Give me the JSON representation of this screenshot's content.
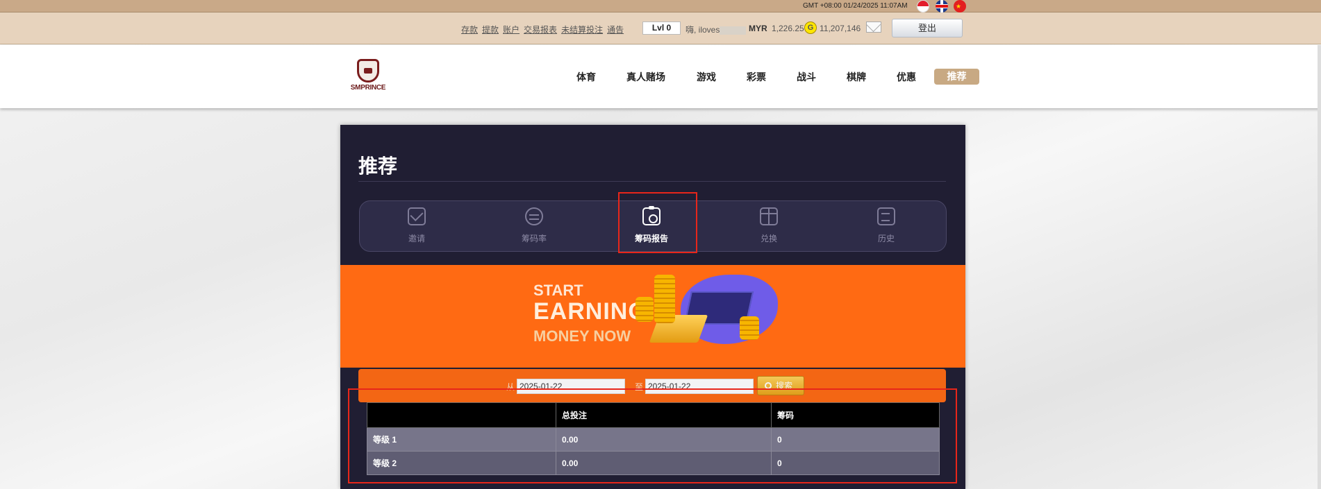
{
  "top_bar": {
    "datetime": "GMT +08:00  01/24/2025 11:07AM",
    "languages": [
      "id-flag-icon",
      "uk-flag-icon",
      "cn-flag-icon"
    ]
  },
  "account_bar": {
    "links": [
      "存款",
      "提款",
      "账户",
      "交易报表",
      "未结算投注",
      "通告"
    ],
    "level": "Lvl 0",
    "greeting": "嗨, iloves",
    "currency": "MYR",
    "balance": "1,226.25",
    "coin_symbol": "G",
    "points": "11,207,146",
    "logout_label": "登出"
  },
  "header": {
    "logo_text": "SMPRINCE",
    "nav": [
      "体育",
      "真人赌场",
      "游戏",
      "彩票",
      "战斗",
      "棋牌",
      "优惠",
      "推荐"
    ],
    "active_nav": "推荐"
  },
  "panel": {
    "title": "推荐",
    "tabs": [
      {
        "label": "邀请",
        "icon": "envelope-icon"
      },
      {
        "label": "筹码率",
        "icon": "coins-icon"
      },
      {
        "label": "筹码报告",
        "icon": "clipboard-report-icon",
        "active": true
      },
      {
        "label": "兑换",
        "icon": "gift-icon"
      },
      {
        "label": "历史",
        "icon": "history-icon"
      }
    ],
    "banner": {
      "line1": "START",
      "line2": "EARNING",
      "line3": "MONEY NOW"
    },
    "search": {
      "from_label": "从",
      "from_value": "2025-01-22",
      "to_label": "至",
      "to_value": "2025-01-22",
      "button_label": "搜索"
    },
    "table": {
      "headers": [
        "",
        "总投注",
        "筹码"
      ],
      "rows": [
        [
          "等级 1",
          "0.00",
          "0"
        ],
        [
          "等级 2",
          "0.00",
          "0"
        ]
      ]
    }
  },
  "colors": {
    "accent_gold": "#c8a983",
    "banner_orange": "#ff6a13",
    "panel_dark": "#201e33",
    "highlight_red": "#e8261a"
  }
}
